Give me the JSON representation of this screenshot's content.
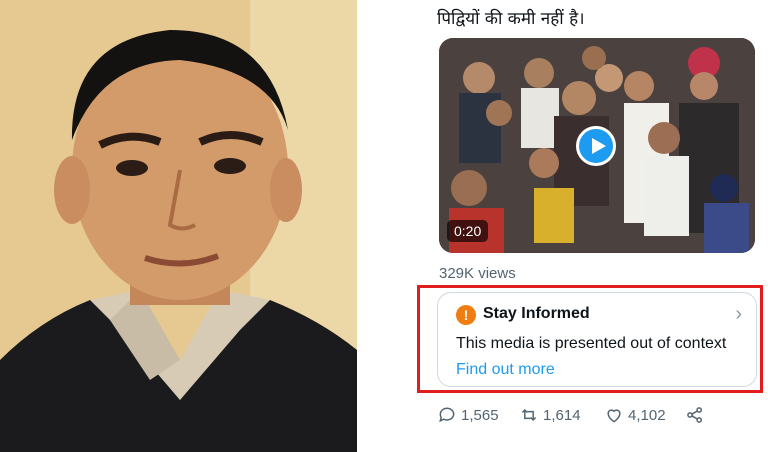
{
  "tweet": {
    "text": "पिद्वियों की कमी नहीं है।",
    "video": {
      "duration": "0:20"
    },
    "views": "329K views",
    "note": {
      "title": "Stay Informed",
      "body": "This media is presented out of context",
      "link": "Find out more"
    },
    "actions": {
      "replies": "1,565",
      "retweets": "1,614",
      "likes": "4,102"
    }
  },
  "colors": {
    "accent": "#1d9bf0",
    "highlight_border": "#e11d1d",
    "warning": "#f07d12"
  }
}
